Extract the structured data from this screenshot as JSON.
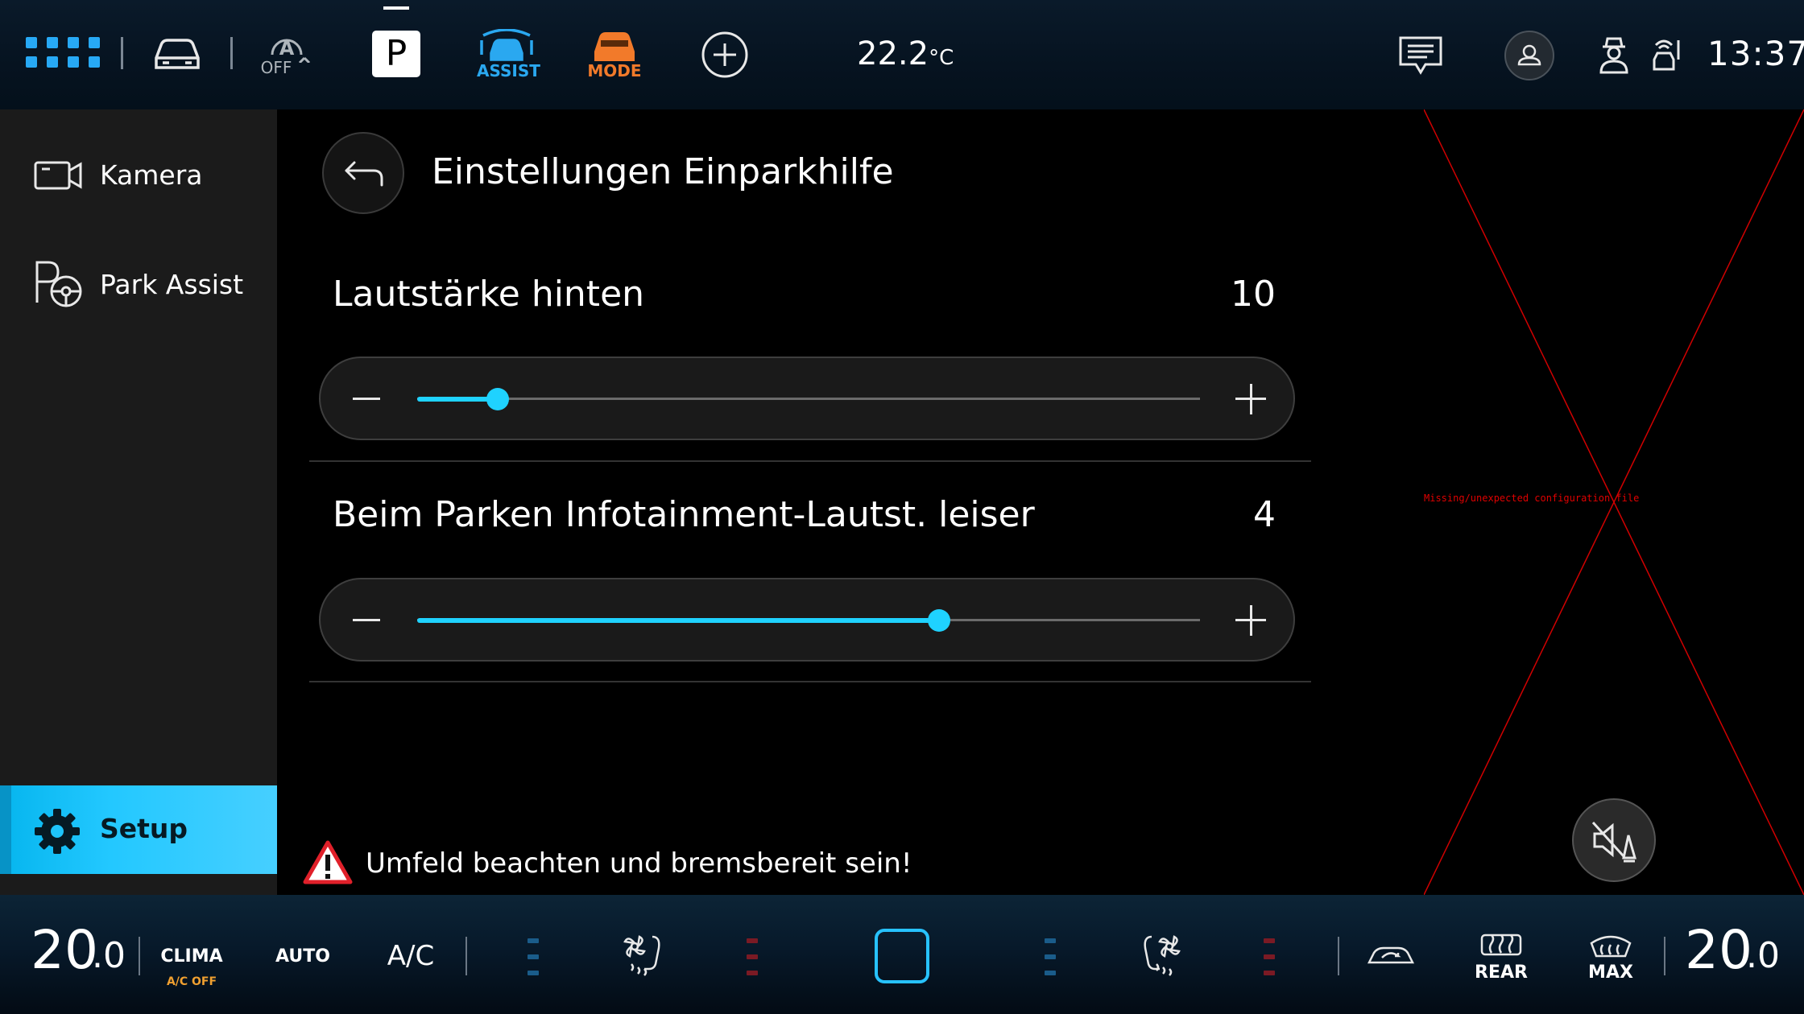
{
  "top_bar": {
    "apps_icon": "grid-icon",
    "car_icon": "car-icon",
    "auto_hold_icon": "auto-hold-icon",
    "auto_hold_label": "OFF",
    "gear_indicator": "P",
    "assist_label": "ASSIST",
    "mode_label": "MODE",
    "add_icon": "plus-circle-icon",
    "outside_temp": "22.2",
    "outside_temp_unit": "°C",
    "message_icon": "message-icon",
    "profile_icon": "user-icon",
    "time": "13:37",
    "colors": {
      "assist": "#2aa8f0",
      "mode": "#f27a2a"
    }
  },
  "sidebar": {
    "items": [
      {
        "label": "Kamera",
        "icon": "camera-icon"
      },
      {
        "label": "Park Assist",
        "icon": "park-assist-icon"
      }
    ],
    "setup": {
      "label": "Setup",
      "icon": "gear-icon",
      "active": true
    }
  },
  "main": {
    "back_icon": "back-arrow-icon",
    "title": "Einstellungen Einparkhilfe",
    "settings": [
      {
        "label": "Lautstärke hinten",
        "value": "10",
        "fraction": 0.103
      },
      {
        "label": "Beim Parken Infotainment-Lautst. leiser",
        "value": "4",
        "fraction": 0.667
      }
    ],
    "warning_text": "Umfeld beachten und bremsbereit sein!",
    "missing_config_text": "Missing/unexpected configuration file",
    "mute_icon": "mute-sound-icon",
    "accent_color": "#1fd2ff"
  },
  "bottom_bar": {
    "left_temp_int": "20",
    "left_temp_dec": ".0",
    "clima_label": "CLIMA",
    "ac_off_label": "A/C OFF",
    "auto_label": "AUTO",
    "ac_label": "A/C",
    "rear_label": "REAR",
    "max_label": "MAX",
    "right_temp_int": "20",
    "right_temp_dec": ".0",
    "colors": {
      "ac_off": "#f0a030",
      "seat_cool": "#1a5c8a",
      "seat_heat": "#7a1a24",
      "sync": "#27c2ff"
    }
  }
}
